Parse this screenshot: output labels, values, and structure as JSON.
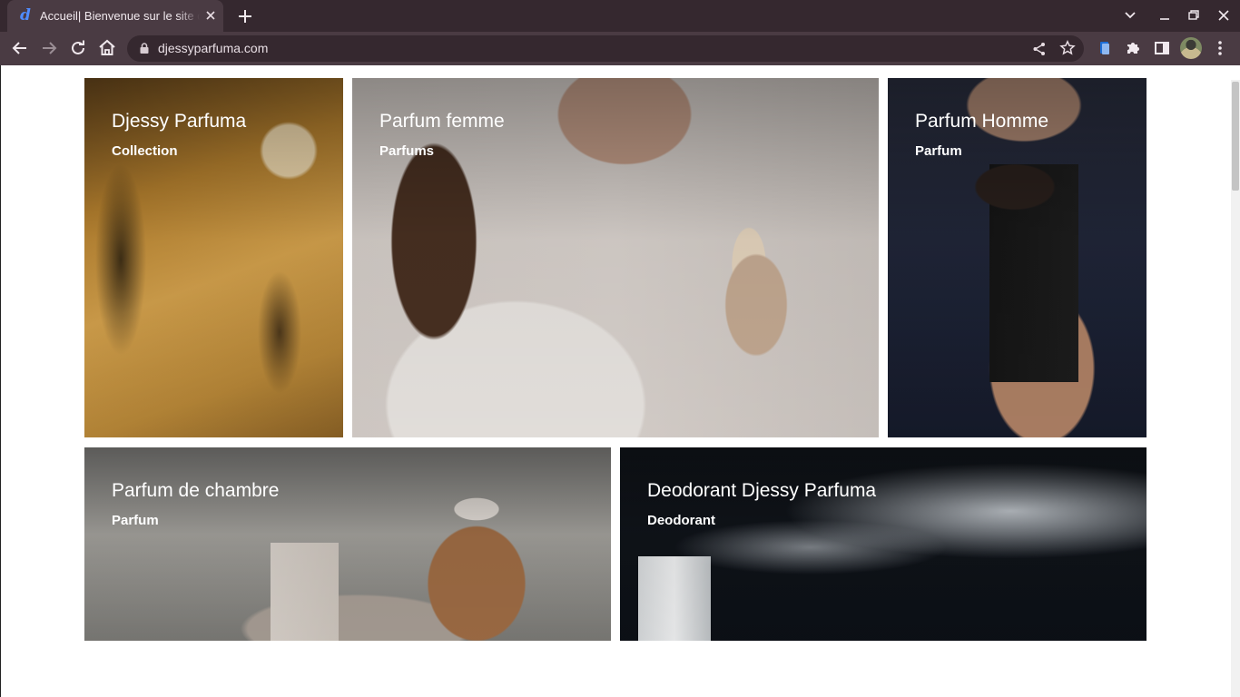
{
  "browser": {
    "tab_title": "Accueil| Bienvenue sur le site de Djessy Parfuma",
    "url": "djessyparfuma.com"
  },
  "colors": {
    "chrome_frame": "#35282f",
    "chrome_toolbar": "#4a3b43",
    "page_background": "#ffffff",
    "card_text": "#ffffff"
  },
  "cards": [
    {
      "title": "Djessy Parfuma",
      "subtitle": "Collection",
      "image": "perfume-bottles-photo"
    },
    {
      "title": "Parfum femme",
      "subtitle": "Parfums",
      "image": "woman-spraying-perfume-photo"
    },
    {
      "title": "Parfum Homme",
      "subtitle": "Parfum",
      "image": "man-holding-perfume-photo"
    },
    {
      "title": "Parfum de chambre",
      "subtitle": "Parfum",
      "image": "candle-and-diffuser-photo"
    },
    {
      "title": "Deodorant Djessy Parfuma",
      "subtitle": "Deodorant",
      "image": "deodorant-spray-photo"
    }
  ]
}
